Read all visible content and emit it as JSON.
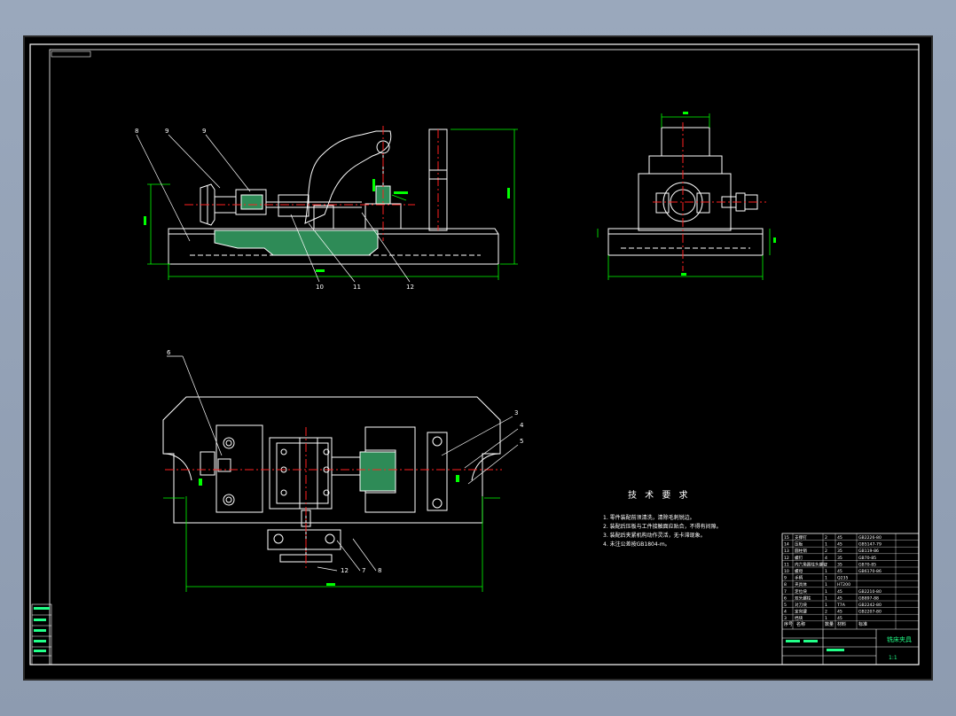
{
  "tech_requirements": {
    "title": "技 术 要 求",
    "items": [
      "1. 零件装配前须清洗，清除毛刺锐边。",
      "2. 装配后压板与工件接触面应贴合，不得有间隙。",
      "3. 装配后夹紧机构动作灵活，无卡滞现象。",
      "4. 未注公差按GB1804-m。"
    ]
  },
  "title_block": {
    "name": "铣床夹具",
    "scale": "1:1"
  },
  "bom": {
    "headers": [
      "序号",
      "名称",
      "数量",
      "材料",
      "标准"
    ],
    "rows": [
      [
        "15",
        "支撑钉",
        "2",
        "45",
        "GB2226-80"
      ],
      [
        "14",
        "压板",
        "1",
        "45",
        "GB5147-79"
      ],
      [
        "13",
        "圆柱销",
        "2",
        "35",
        "GB119-86"
      ],
      [
        "12",
        "螺钉",
        "4",
        "35",
        "GB70-85"
      ],
      [
        "11",
        "内六角圆柱头螺钉",
        "2",
        "35",
        "GB70-85"
      ],
      [
        "10",
        "螺母",
        "1",
        "45",
        "GB6170-86"
      ],
      [
        "9",
        "手柄",
        "1",
        "Q235",
        ""
      ],
      [
        "8",
        "夹具体",
        "1",
        "HT200",
        ""
      ],
      [
        "7",
        "定位块",
        "1",
        "45",
        "GB2210-80"
      ],
      [
        "6",
        "双头螺柱",
        "1",
        "45",
        "GB897-88"
      ],
      [
        "5",
        "对刀块",
        "1",
        "T7A",
        "GB2242-80"
      ],
      [
        "4",
        "定向键",
        "2",
        "45",
        "GB2207-80"
      ],
      [
        "3",
        "挡块",
        "1",
        "45",
        ""
      ]
    ]
  },
  "callouts": {
    "front": [
      "8",
      "9",
      "9",
      "10",
      "11",
      "12"
    ],
    "plan": [
      "6",
      "3",
      "4",
      "5",
      "12",
      "7",
      "8"
    ]
  },
  "colors": {
    "background": "#000000",
    "outline": "#ffffff",
    "centerline": "#ff2020",
    "dimension": "#00ff00",
    "section": "#2e8b57",
    "leader": "#ffffff"
  }
}
